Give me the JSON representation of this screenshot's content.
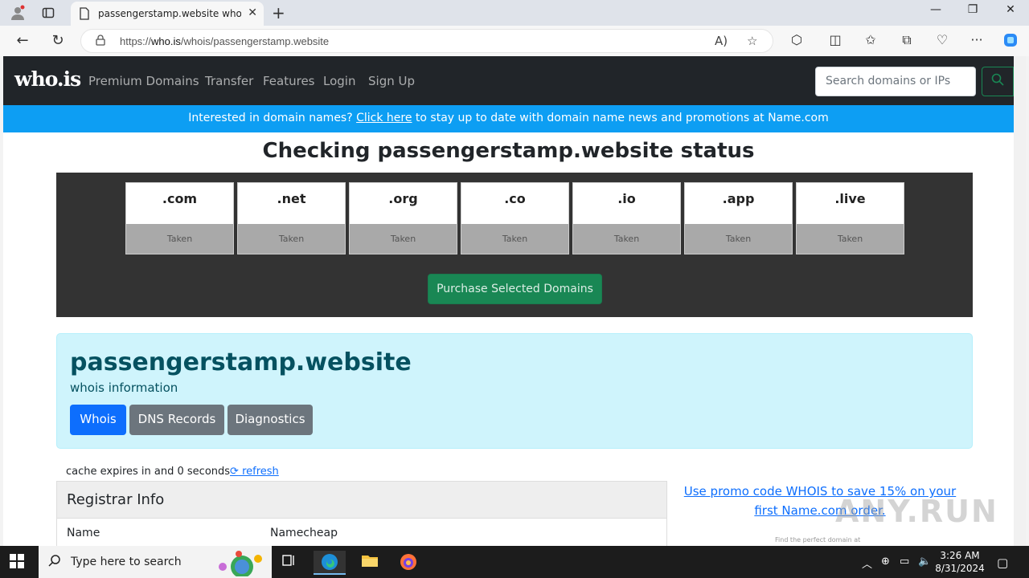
{
  "browser": {
    "tab_title": "passengerstamp.website whois lo",
    "url_prefix": "https://",
    "url_host": "who.is",
    "url_path": "/whois/passengerstamp.website"
  },
  "site": {
    "logo": "who.is",
    "nav": [
      "Premium Domains",
      "Transfer",
      "Features",
      "Login",
      "Sign Up"
    ],
    "search_placeholder": "Search domains or IPs"
  },
  "promo_bar": {
    "before": "Interested in domain names? ",
    "link": "Click here",
    "after": " to stay up to date with domain name news and promotions at Name.com"
  },
  "heading": "Checking passengerstamp.website status",
  "tlds": [
    {
      "name": ".com",
      "status": "Taken"
    },
    {
      "name": ".net",
      "status": "Taken"
    },
    {
      "name": ".org",
      "status": "Taken"
    },
    {
      "name": ".co",
      "status": "Taken"
    },
    {
      "name": ".io",
      "status": "Taken"
    },
    {
      "name": ".app",
      "status": "Taken"
    },
    {
      "name": ".live",
      "status": "Taken"
    }
  ],
  "purchase_label": "Purchase Selected Domains",
  "info": {
    "domain": "passengerstamp.website",
    "subtitle": "whois information",
    "tabs": [
      "Whois",
      "DNS Records",
      "Diagnostics"
    ]
  },
  "cache": {
    "text": "cache expires in and 0 seconds",
    "refresh": " refresh"
  },
  "registrar": {
    "title": "Registrar Info",
    "label": "Name",
    "value": "Namecheap"
  },
  "side_promo": "Use promo code WHOIS to save 15% on your first Name.com order.",
  "side_small": "Find the perfect domain at",
  "watermark": "ANY.RUN",
  "taskbar": {
    "search_text": "Type here to search",
    "time": "3:26 AM",
    "date": "8/31/2024"
  },
  "colors": {
    "navbar": "#212529",
    "promo": "#0d9ef3",
    "success": "#198754",
    "primary": "#0d6efd",
    "info_bg": "#cff4fc"
  }
}
